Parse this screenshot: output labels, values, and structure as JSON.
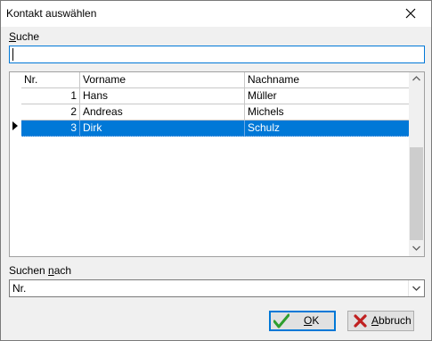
{
  "window": {
    "title": "Kontakt auswählen"
  },
  "search": {
    "label_first": "S",
    "label_rest": "uche",
    "value": ""
  },
  "grid": {
    "columns": [
      "Nr.",
      "Vorname",
      "Nachname"
    ],
    "rows": [
      {
        "nr": "1",
        "vorname": "Hans",
        "nachname": "Müller"
      },
      {
        "nr": "2",
        "vorname": "Andreas",
        "nachname": "Michels"
      },
      {
        "nr": "3",
        "vorname": "Dirk",
        "nachname": "Schulz"
      }
    ],
    "selected_row": 3
  },
  "search_by": {
    "label_prefix": "Suchen ",
    "label_u": "n",
    "label_rest": "ach",
    "selected": "Nr."
  },
  "buttons": {
    "ok": {
      "label_u": "O",
      "label_rest": "K"
    },
    "cancel": {
      "label_u": "A",
      "label_rest": "bbruch"
    }
  },
  "colors": {
    "selection": "#0078d7",
    "focus_border": "#0078d7",
    "ok_check": "#2e9e2e",
    "cancel_x": "#c02020"
  }
}
